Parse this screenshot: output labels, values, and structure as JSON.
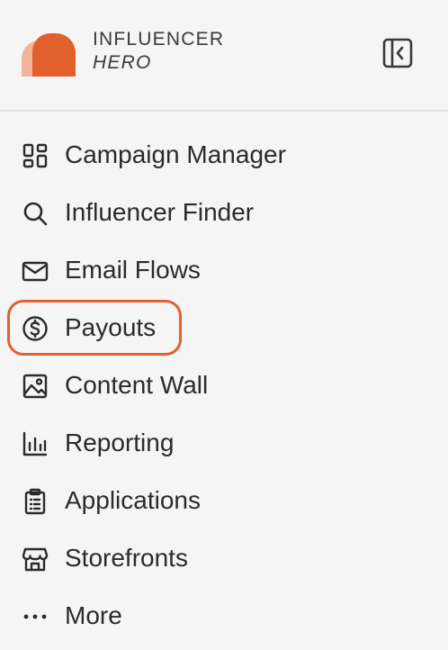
{
  "brand": {
    "line1": "INFLUENCER",
    "line2": "HERO",
    "logo_colors": [
      "#e2602e",
      "#f0b49a"
    ]
  },
  "header": {
    "collapse_icon": "sidebar-collapse-icon"
  },
  "nav": {
    "items": [
      {
        "label": "Campaign Manager",
        "icon": "dashboard-grid-icon"
      },
      {
        "label": "Influencer Finder",
        "icon": "search-icon"
      },
      {
        "label": "Email Flows",
        "icon": "mail-icon"
      },
      {
        "label": "Payouts",
        "icon": "dollar-circle-icon"
      },
      {
        "label": "Content Wall",
        "icon": "image-icon"
      },
      {
        "label": "Reporting",
        "icon": "bar-chart-icon"
      },
      {
        "label": "Applications",
        "icon": "clipboard-icon"
      },
      {
        "label": "Storefronts",
        "icon": "storefront-icon"
      },
      {
        "label": "More",
        "icon": "more-dots-icon"
      }
    ],
    "highlighted_item": "Payouts",
    "highlight_color": "#e2602e"
  }
}
